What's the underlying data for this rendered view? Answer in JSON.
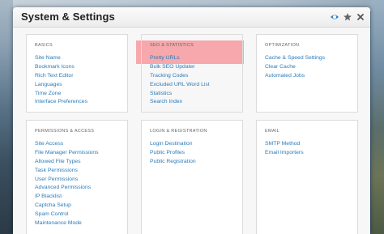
{
  "window": {
    "title": "System & Settings",
    "icons": [
      "watch-icon",
      "star-icon",
      "close-icon"
    ]
  },
  "panels": {
    "basics": {
      "title": "BASICS",
      "items": [
        "Site Name",
        "Bookmark Icons",
        "Rich Text Editor",
        "Languages",
        "Time Zone",
        "Interface Preferences"
      ]
    },
    "seo": {
      "title": "SEO & STATISTICS",
      "items": [
        "Pretty URLs",
        "Bulk SEO Updater",
        "Tracking Codes",
        "Excluded URL Word List",
        "Statistics",
        "Search Index"
      ]
    },
    "optimization": {
      "title": "OPTIMIZATION",
      "items": [
        "Cache & Speed Settings",
        "Clear Cache",
        "Automated Jobs"
      ]
    },
    "permissions": {
      "title": "PERMISSIONS & ACCESS",
      "items": [
        "Site Access",
        "File Manager Permissions",
        "Allowed File Types",
        "Task Permissions",
        "User Permissions",
        "Advanced Permissions",
        "IP Blacklist",
        "Captcha Setup",
        "Spam Control",
        "Maintenance Mode"
      ]
    },
    "login": {
      "title": "LOGIN & REGISTRATION",
      "items": [
        "Login Destination",
        "Public Profiles",
        "Public Registration"
      ]
    },
    "email": {
      "title": "EMAIL",
      "items": [
        "SMTP Method",
        "Email Importers"
      ]
    }
  },
  "colors": {
    "link": "#2b7bb9",
    "highlight": "#f5a3a8"
  }
}
